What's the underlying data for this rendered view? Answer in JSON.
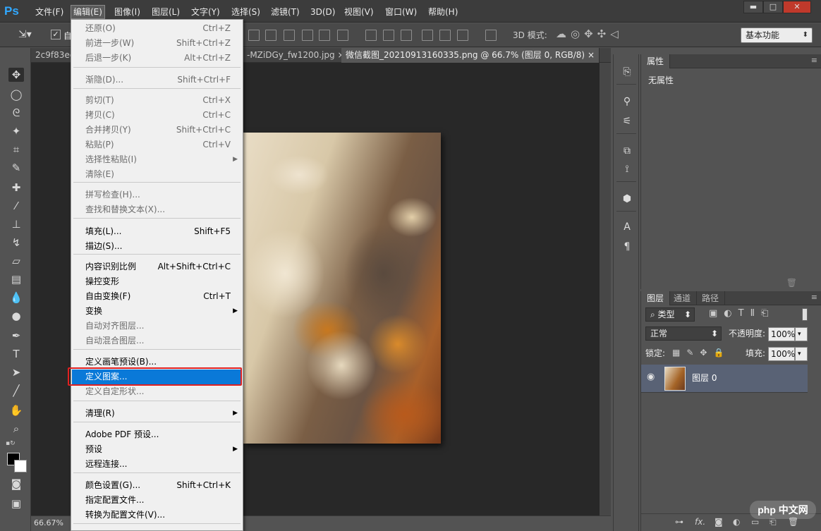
{
  "app": {
    "logo": "Ps"
  },
  "menubar": {
    "items": [
      "文件(F)",
      "编辑(E)",
      "图像(I)",
      "图层(L)",
      "文字(Y)",
      "选择(S)",
      "滤镜(T)",
      "3D(D)",
      "视图(V)",
      "窗口(W)",
      "帮助(H)"
    ],
    "active": "编辑(E)"
  },
  "window_controls": {
    "minimize": "▬",
    "maximize": "□",
    "close": "✕"
  },
  "options_bar": {
    "mode_3d_label": "3D 模式:",
    "workspace": "基本功能",
    "auto_select_partial": "自"
  },
  "doc_tabs": [
    {
      "label": "2c9f83ee",
      "active": false
    },
    {
      "label": "-MZiDGy_fw1200.jpg",
      "active": false,
      "close": "×"
    },
    {
      "label": "微信截图_20210913160335.png @ 66.7% (图层 0, RGB/8)",
      "active": true,
      "close": "×"
    }
  ],
  "status": {
    "zoom": "66.67%"
  },
  "edit_menu": {
    "items": [
      {
        "label": "还原(O)",
        "shortcut": "Ctrl+Z",
        "disabled": true
      },
      {
        "label": "前进一步(W)",
        "shortcut": "Shift+Ctrl+Z",
        "disabled": true
      },
      {
        "label": "后退一步(K)",
        "shortcut": "Alt+Ctrl+Z",
        "disabled": true
      },
      {
        "label": "渐隐(D)...",
        "shortcut": "Shift+Ctrl+F",
        "disabled": true
      },
      {
        "label": "剪切(T)",
        "shortcut": "Ctrl+X",
        "disabled": true
      },
      {
        "label": "拷贝(C)",
        "shortcut": "Ctrl+C",
        "disabled": true
      },
      {
        "label": "合并拷贝(Y)",
        "shortcut": "Shift+Ctrl+C",
        "disabled": true
      },
      {
        "label": "粘贴(P)",
        "shortcut": "Ctrl+V",
        "disabled": true
      },
      {
        "label": "选择性粘贴(I)",
        "shortcut": "",
        "disabled": true,
        "submenu": true
      },
      {
        "label": "清除(E)",
        "shortcut": "",
        "disabled": true
      },
      {
        "label": "拼写检查(H)...",
        "shortcut": "",
        "disabled": true
      },
      {
        "label": "查找和替换文本(X)...",
        "shortcut": "",
        "disabled": true
      },
      {
        "label": "填充(L)...",
        "shortcut": "Shift+F5",
        "disabled": false
      },
      {
        "label": "描边(S)...",
        "shortcut": "",
        "disabled": false
      },
      {
        "label": "内容识别比例",
        "shortcut": "Alt+Shift+Ctrl+C",
        "disabled": false
      },
      {
        "label": "操控变形",
        "shortcut": "",
        "disabled": false
      },
      {
        "label": "自由变换(F)",
        "shortcut": "Ctrl+T",
        "disabled": false
      },
      {
        "label": "变换",
        "shortcut": "",
        "disabled": false,
        "submenu": true
      },
      {
        "label": "自动对齐图层...",
        "shortcut": "",
        "disabled": true
      },
      {
        "label": "自动混合图层...",
        "shortcut": "",
        "disabled": true
      },
      {
        "label": "定义画笔预设(B)...",
        "shortcut": "",
        "disabled": false
      },
      {
        "label": "定义图案...",
        "shortcut": "",
        "disabled": false,
        "highlighted": true
      },
      {
        "label": "定义自定形状...",
        "shortcut": "",
        "disabled": true
      },
      {
        "label": "清理(R)",
        "shortcut": "",
        "disabled": false,
        "submenu": true
      },
      {
        "label": "Adobe PDF 预设...",
        "shortcut": "",
        "disabled": false
      },
      {
        "label": "预设",
        "shortcut": "",
        "disabled": false,
        "submenu": true
      },
      {
        "label": "远程连接...",
        "shortcut": "",
        "disabled": false
      },
      {
        "label": "颜色设置(G)...",
        "shortcut": "Shift+Ctrl+K",
        "disabled": false
      },
      {
        "label": "指定配置文件...",
        "shortcut": "",
        "disabled": false
      },
      {
        "label": "转换为配置文件(V)...",
        "shortcut": "",
        "disabled": false
      }
    ]
  },
  "properties_panel": {
    "tab": "属性",
    "empty_text": "无属性"
  },
  "layers_panel": {
    "tabs": [
      "图层",
      "通道",
      "路径"
    ],
    "filter_kind": "类型",
    "blend_mode": "正常",
    "opacity_label": "不透明度:",
    "opacity_value": "100%",
    "lock_label": "锁定:",
    "fill_label": "填充:",
    "fill_value": "100%",
    "layers": [
      {
        "name": "图层 0",
        "visible": true
      }
    ]
  },
  "watermark": {
    "text": "php 中文网"
  }
}
